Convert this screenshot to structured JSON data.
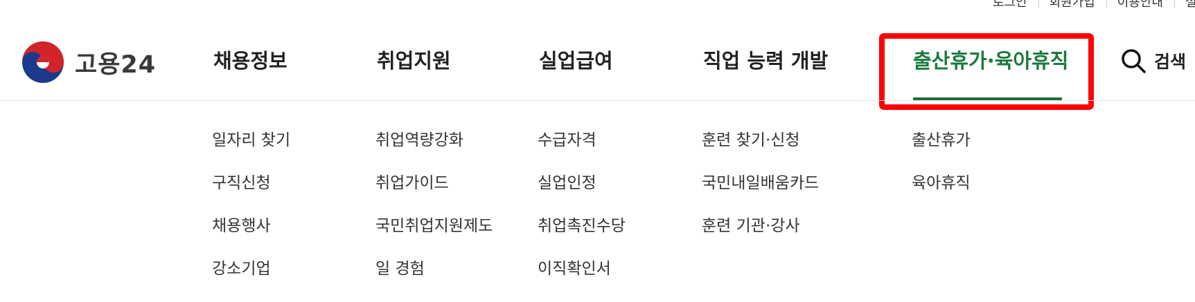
{
  "utility": [
    "로그인",
    "회원가입",
    "이용안내",
    "설정"
  ],
  "logo": {
    "text": "고용24"
  },
  "gnb": [
    {
      "label": "채용정보"
    },
    {
      "label": "취업지원"
    },
    {
      "label": "실업급여"
    },
    {
      "label": "직업 능력 개발"
    },
    {
      "label": "출산휴가·육아휴직"
    }
  ],
  "search": {
    "label": "검색",
    "icon": "search-icon"
  },
  "submenu": [
    [
      "일자리 찾기",
      "구직신청",
      "채용행사",
      "강소기업"
    ],
    [
      "취업역량강화",
      "취업가이드",
      "국민취업지원제도",
      "일 경험"
    ],
    [
      "수급자격",
      "실업인정",
      "취업촉진수당",
      "이직확인서"
    ],
    [
      "훈련 찾기·신청",
      "국민내일배움카드",
      "훈련 기관·강사"
    ],
    [
      "출산휴가",
      "육아휴직"
    ]
  ],
  "colors": {
    "active_green": "#1a7a3c",
    "highlight_red": "#ff0000",
    "logo_red": "#d2232a",
    "logo_blue": "#1b3b8a"
  }
}
